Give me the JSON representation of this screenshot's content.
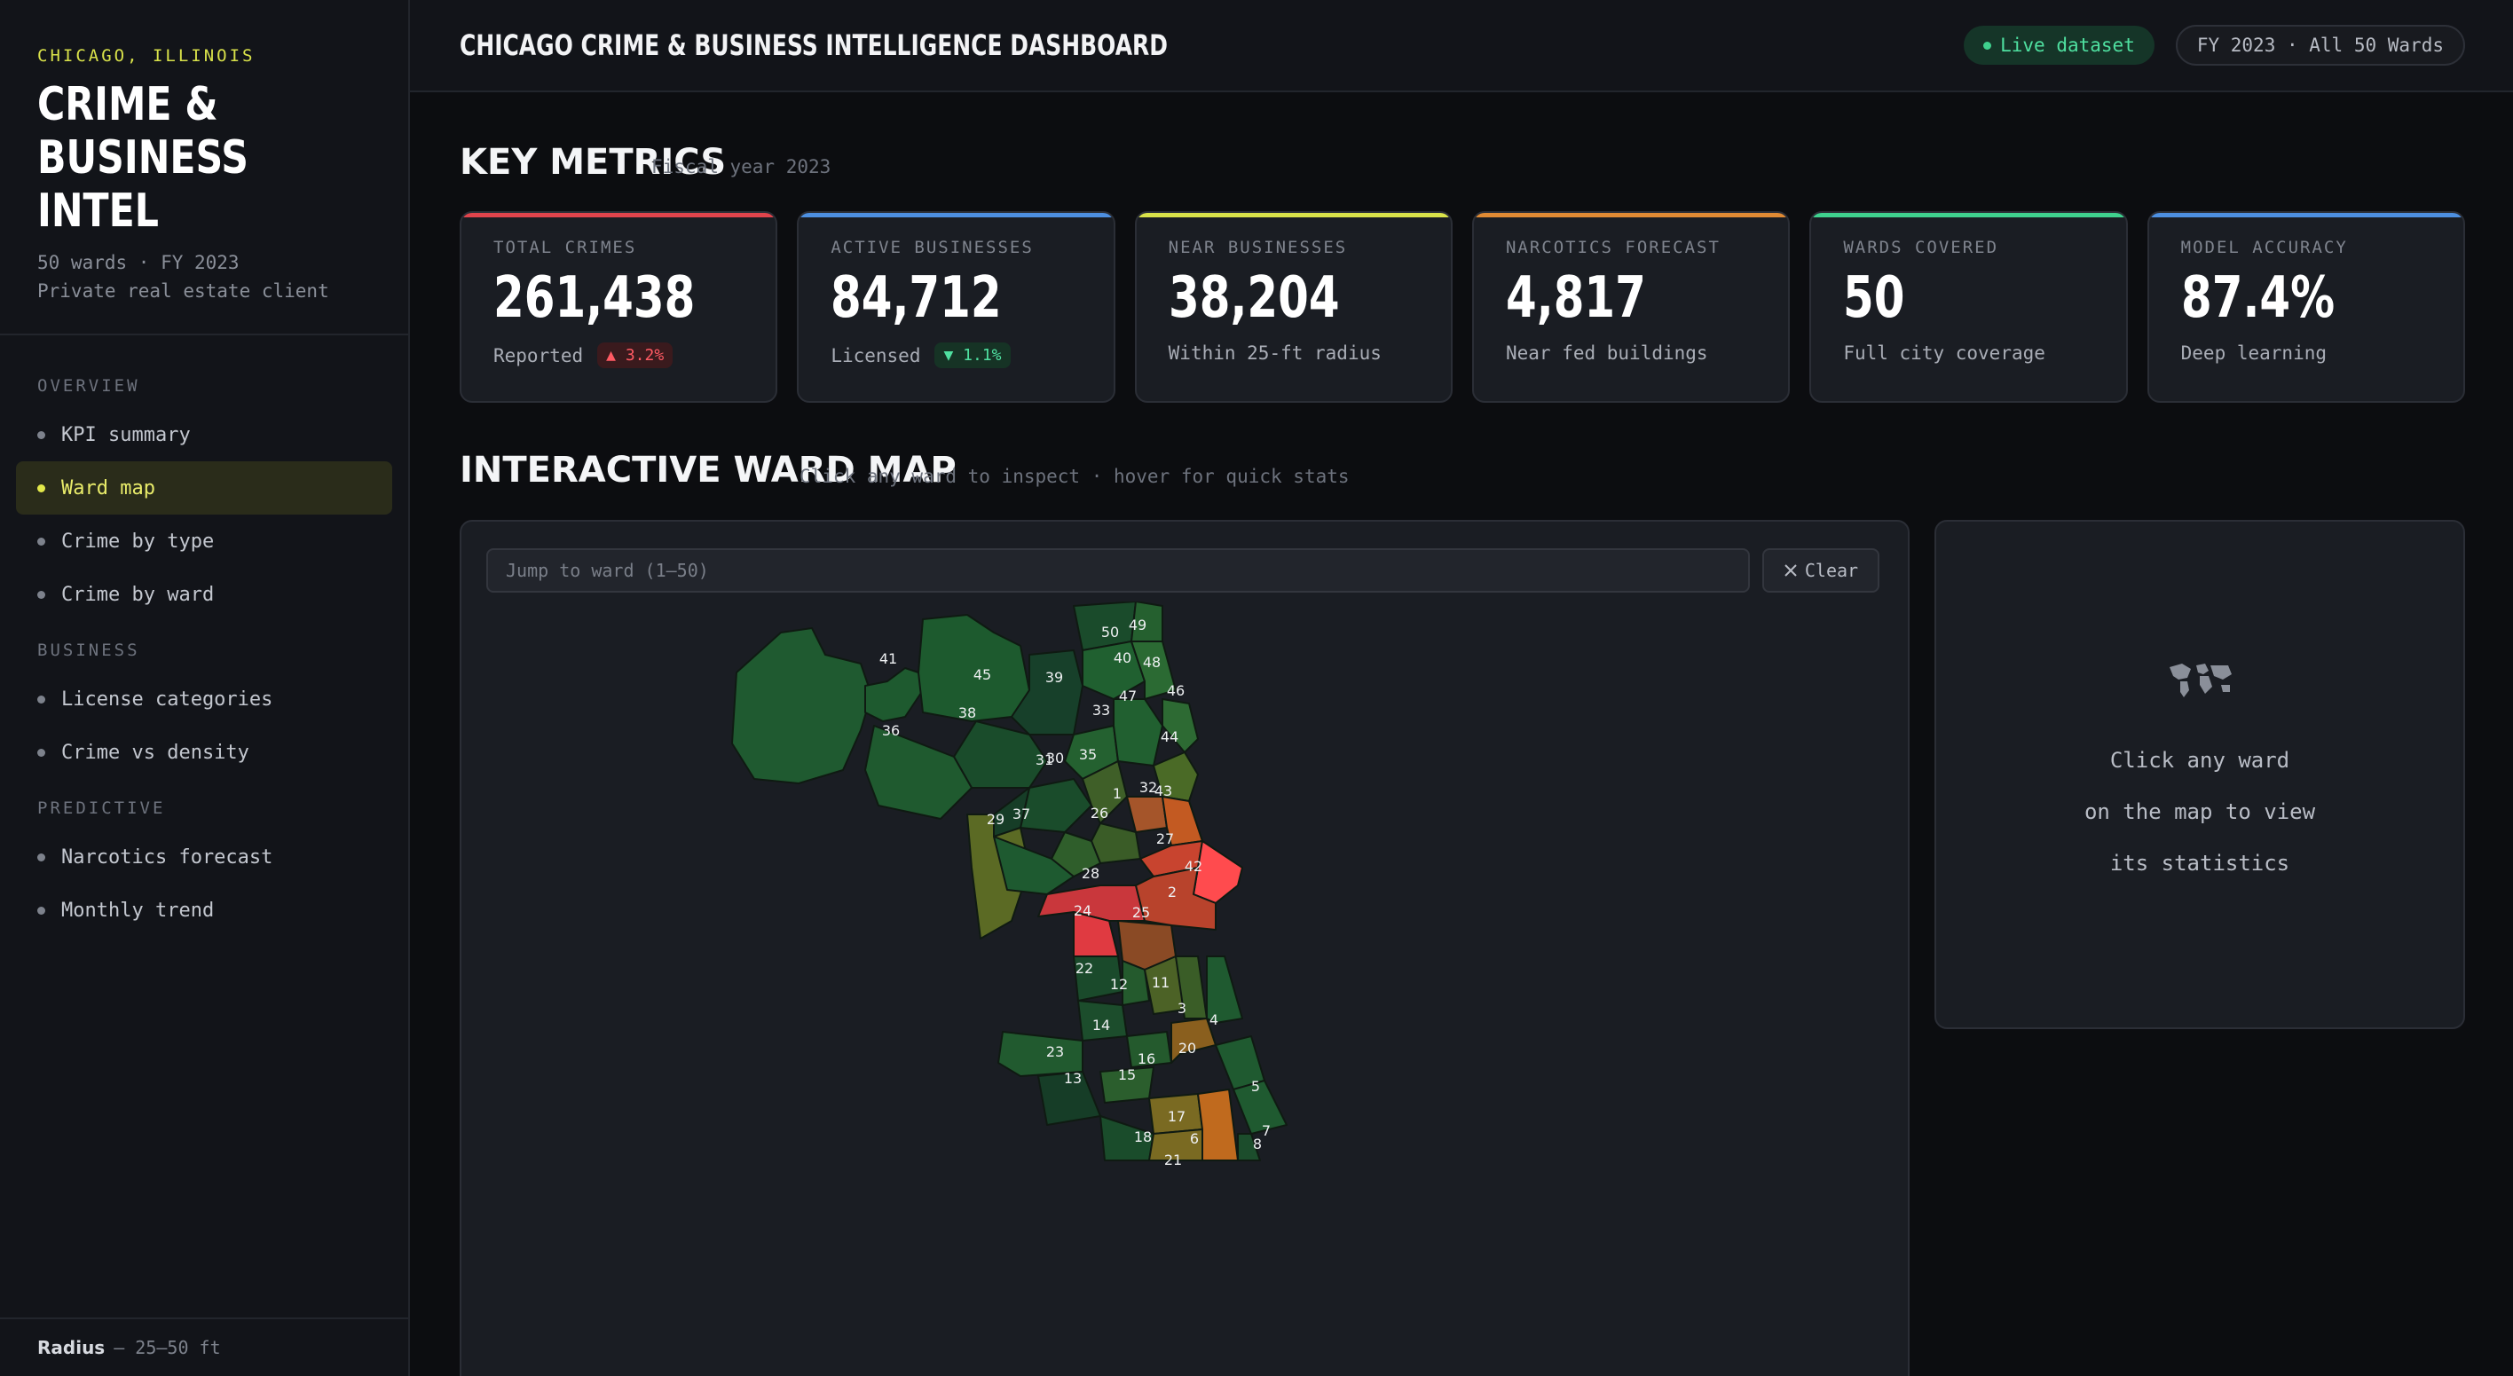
{
  "sidebar": {
    "kicker": "CHICAGO, ILLINOIS",
    "title": "CRIME & BUSINESS INTEL",
    "meta_line1": "50 wards · FY 2023",
    "meta_line2": "Private real estate client",
    "sections": [
      {
        "label": "OVERVIEW",
        "items": [
          "KPI summary",
          "Ward map",
          "Crime by type",
          "Crime by ward"
        ]
      },
      {
        "label": "BUSINESS",
        "items": [
          "License categories",
          "Crime vs density"
        ]
      },
      {
        "label": "PREDICTIVE",
        "items": [
          "Narcotics forecast",
          "Monthly trend"
        ]
      }
    ],
    "active_item": "Ward map",
    "footer_label": "Radius",
    "footer_value": "— 25–50 ft"
  },
  "topbar": {
    "title": "CHICAGO CRIME & BUSINESS INTELLIGENCE DASHBOARD",
    "live_label": "Live dataset",
    "fy_label": "FY 2023 · All 50 Wards",
    "live_color": "#3fd18e"
  },
  "metrics": {
    "title": "KEY METRICS",
    "subtitle": "Fiscal year 2023",
    "cards": [
      {
        "label": "TOTAL CRIMES",
        "value": "261,438",
        "sub": "Reported",
        "badge": "▲ 3.2%",
        "accent": "#e0444c"
      },
      {
        "label": "ACTIVE BUSINESSES",
        "value": "84,712",
        "sub": "Licensed",
        "badge": "▼ 1.1%",
        "accent": "#4d8fe0"
      },
      {
        "label": "NEAR BUSINESSES",
        "value": "38,204",
        "sub": "Within 25-ft radius",
        "accent": "#d9e24a"
      },
      {
        "label": "NARCOTICS FORECAST",
        "value": "4,817",
        "sub": "Near fed buildings",
        "accent": "#e08a34"
      },
      {
        "label": "WARDS COVERED",
        "value": "50",
        "sub": "Full city coverage",
        "accent": "#3fd18e"
      },
      {
        "label": "MODEL ACCURACY",
        "value": "87.4%",
        "sub": "Deep learning",
        "accent": "#4d8fe0"
      }
    ]
  },
  "map": {
    "title": "INTERACTIVE WARD MAP",
    "subtitle": "Click any ward to inspect · hover for quick stats",
    "search_placeholder": "Jump to ward (1–50)",
    "clear_label": "Clear",
    "ward_labels": [
      "50",
      "49",
      "41",
      "40",
      "48",
      "45",
      "39",
      "46",
      "47",
      "38",
      "33",
      "36",
      "44",
      "30",
      "31",
      "35",
      "32",
      "43",
      "1",
      "26",
      "29",
      "37",
      "27",
      "42",
      "28",
      "2",
      "24",
      "25",
      "22",
      "12",
      "11",
      "3",
      "4",
      "14",
      "23",
      "16",
      "20",
      "13",
      "15",
      "5",
      "17",
      "18",
      "6",
      "7",
      "8",
      "21"
    ]
  },
  "info": {
    "line1": "Click any ward",
    "line2": "on the map to view",
    "line3": "its statistics",
    "icon": "world-map-icon"
  }
}
